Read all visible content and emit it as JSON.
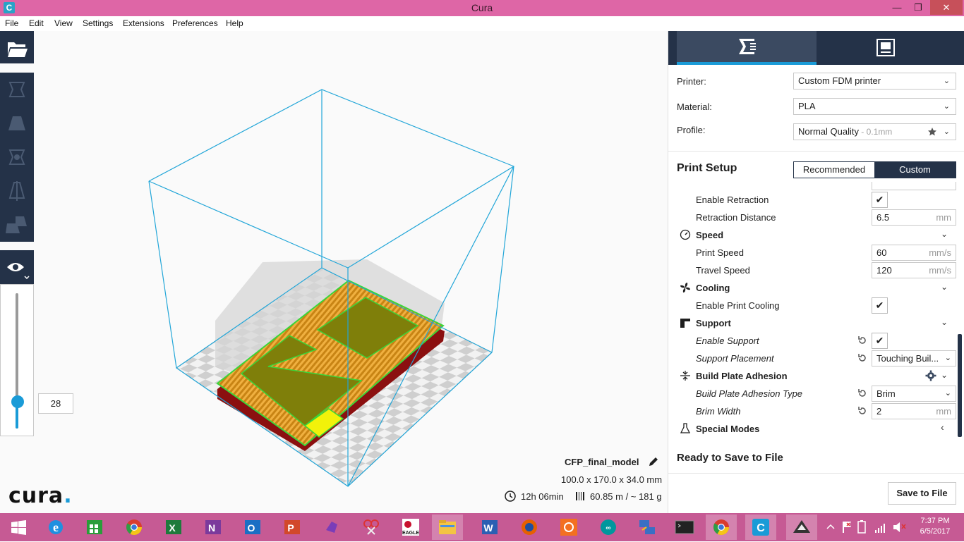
{
  "window": {
    "title": "Cura",
    "app_icon": "C",
    "controls": {
      "minimize": "minimize-icon",
      "maximize": "restore-icon",
      "close": "close-icon"
    }
  },
  "menu": [
    "File",
    "Edit",
    "View",
    "Settings",
    "Extensions",
    "Preferences",
    "Help"
  ],
  "toolbar": {
    "open": "folder-open-icon",
    "tools": [
      "translate-icon",
      "scale-icon",
      "rotate-icon",
      "mirror-icon",
      "per-model-settings-icon"
    ],
    "view": "eye-icon"
  },
  "layer_view": {
    "current_layer": "28",
    "slider_fraction": 0.2
  },
  "logo": {
    "text": "cura",
    "dot": "."
  },
  "job": {
    "name": "CFP_final_model",
    "dimensions": "100.0 x 170.0 x 34.0 mm",
    "print_time": "12h 06min",
    "material_usage": "60.85 m / ~ 181 g"
  },
  "sidebar": {
    "tabs": [
      "prepare-icon",
      "monitor-icon"
    ],
    "printer_label": "Printer:",
    "printer_value": "Custom FDM printer",
    "material_label": "Material:",
    "material_value": "PLA",
    "profile_label": "Profile:",
    "profile_value": "Normal Quality",
    "profile_suffix": " - 0.1mm",
    "print_setup_title": "Print Setup",
    "mode_recommended": "Recommended",
    "mode_custom": "Custom",
    "settings": {
      "enable_retraction": "Enable Retraction",
      "retraction_distance": "Retraction Distance",
      "retraction_distance_value": "6.5",
      "retraction_distance_unit": "mm",
      "speed": "Speed",
      "print_speed": "Print Speed",
      "print_speed_value": "60",
      "print_speed_unit": "mm/s",
      "travel_speed": "Travel Speed",
      "travel_speed_value": "120",
      "travel_speed_unit": "mm/s",
      "cooling": "Cooling",
      "enable_print_cooling": "Enable Print Cooling",
      "support": "Support",
      "enable_support": "Enable Support",
      "support_placement": "Support Placement",
      "support_placement_value": "Touching Buil...",
      "adhesion": "Build Plate Adhesion",
      "adhesion_type": "Build Plate Adhesion Type",
      "adhesion_type_value": "Brim",
      "brim_width": "Brim Width",
      "brim_width_value": "2",
      "brim_width_unit": "mm",
      "special_modes": "Special Modes"
    },
    "check_mark": "✔",
    "ready_text": "Ready to Save to File",
    "save_button": "Save to File"
  },
  "taskbar": {
    "apps": [
      "windows-start-icon",
      "internet-explorer-icon",
      "store-icon",
      "chrome-icon",
      "excel-icon",
      "onenote-icon",
      "outlook-icon",
      "powerpoint-icon",
      "visual-studio-icon",
      "snipping-tool-icon",
      "eagle-icon",
      "file-explorer-icon",
      "word-icon",
      "firefox-icon",
      "blender-icon",
      "arduino-icon",
      "network-tool-icon",
      "terminal-icon",
      "chrome-icon",
      "cura-icon",
      "inkscape-icon"
    ],
    "time": "7:37 PM",
    "date": "6/5/2017"
  },
  "colors": {
    "titlebar": "#de66a6",
    "toolbar_dark": "#243248",
    "accent": "#1a9bd7",
    "taskbar": "#c65a94",
    "model_fill": "#7f7f0a",
    "model_infill": "#e39a22"
  }
}
